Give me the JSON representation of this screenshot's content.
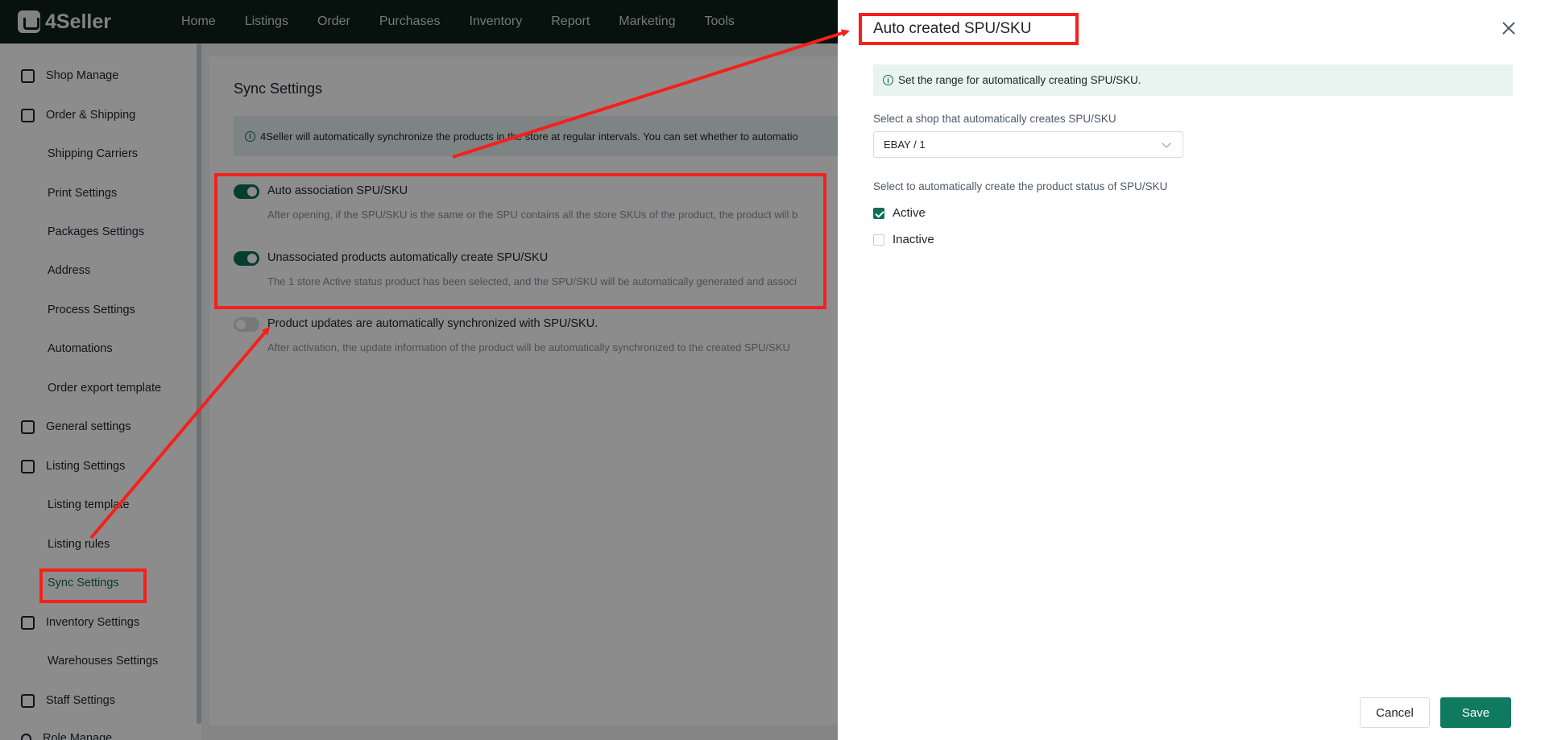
{
  "app": {
    "logo_text": "4Seller",
    "nav": [
      "Home",
      "Listings",
      "Order",
      "Purchases",
      "Inventory",
      "Report",
      "Marketing",
      "Tools"
    ]
  },
  "sidebar": {
    "items": [
      {
        "label": "Shop Manage",
        "type": "group",
        "icon": "shop-icon"
      },
      {
        "label": "Order & Shipping",
        "type": "group",
        "icon": "order-icon"
      },
      {
        "label": "Shipping Carriers",
        "type": "sub"
      },
      {
        "label": "Print Settings",
        "type": "sub"
      },
      {
        "label": "Packages Settings",
        "type": "sub"
      },
      {
        "label": "Address",
        "type": "sub"
      },
      {
        "label": "Process Settings",
        "type": "sub"
      },
      {
        "label": "Automations",
        "type": "sub"
      },
      {
        "label": "Order export template",
        "type": "sub"
      },
      {
        "label": "General settings",
        "type": "group",
        "icon": "general-icon"
      },
      {
        "label": "Listing Settings",
        "type": "group",
        "icon": "listing-icon"
      },
      {
        "label": "Listing template",
        "type": "sub"
      },
      {
        "label": "Listing rules",
        "type": "sub"
      },
      {
        "label": "Sync Settings",
        "type": "sub",
        "active": true
      },
      {
        "label": "Inventory Settings",
        "type": "group",
        "icon": "inventory-icon"
      },
      {
        "label": "Warehouses Settings",
        "type": "sub"
      },
      {
        "label": "Staff Settings",
        "type": "group",
        "icon": "staff-icon"
      },
      {
        "label": "Role Manage",
        "type": "group",
        "icon": "role-icon"
      }
    ]
  },
  "main": {
    "title": "Sync Settings",
    "info": "4Seller will automatically synchronize the products in the store at regular intervals. You can set whether to automatio",
    "settings": [
      {
        "title": "Auto association SPU/SKU",
        "desc": "After opening, if the SPU/SKU is the same or the SPU contains all the store SKUs of the product, the product will b",
        "enabled": true
      },
      {
        "title": "Unassociated products automatically create SPU/SKU",
        "desc": "The 1 store Active status product has been selected, and the SPU/SKU will be automatically generated and associ",
        "enabled": true
      },
      {
        "title": "Product updates are automatically synchronized with SPU/SKU.",
        "desc": "After activation, the update information of the product will be automatically synchronized to the created SPU/SKU",
        "enabled": false
      }
    ]
  },
  "drawer": {
    "title": "Auto created SPU/SKU",
    "info": "Set the range for automatically creating SPU/SKU.",
    "shop_label": "Select a shop that automatically creates SPU/SKU",
    "shop_value": "EBAY / 1",
    "status_label": "Select to automatically create the product status of SPU/SKU",
    "options": [
      {
        "label": "Active",
        "checked": true
      },
      {
        "label": "Inactive",
        "checked": false
      }
    ],
    "cancel_label": "Cancel",
    "save_label": "Save"
  },
  "colors": {
    "accent": "#0f7a5f",
    "annotation": "#f5201c"
  }
}
